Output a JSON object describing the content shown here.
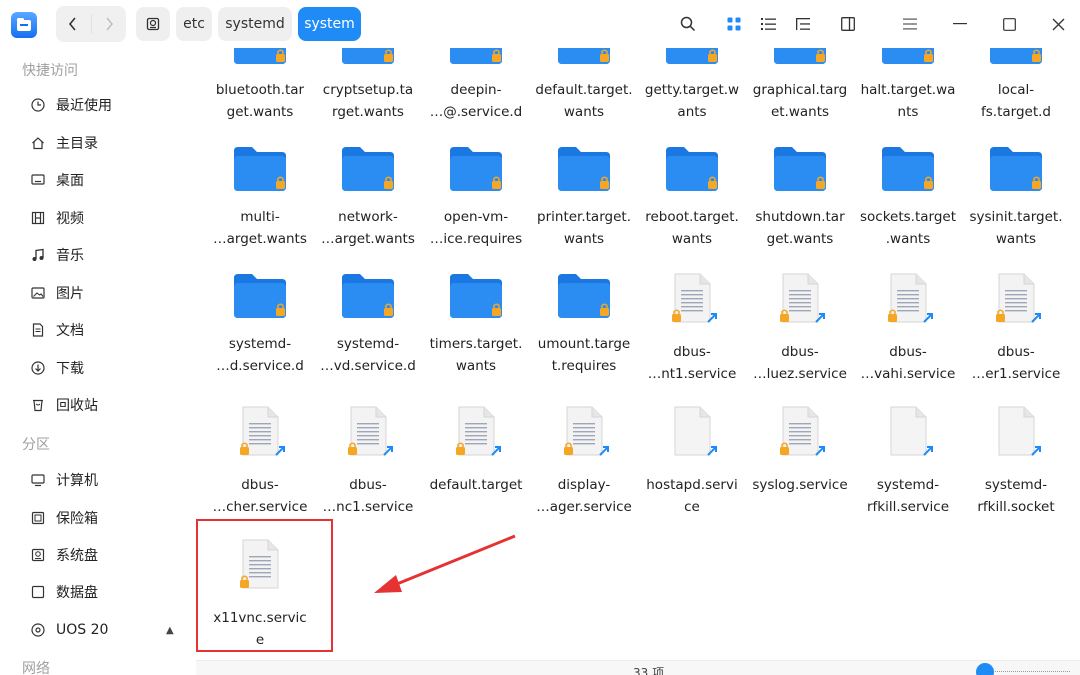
{
  "titlebar": {
    "breadcrumbs": [
      "etc",
      "systemd",
      "system"
    ],
    "back_icon": "chevron-left",
    "forward_icon": "chevron-right",
    "drive_icon": "disk-icon"
  },
  "sidebar": {
    "groups": {
      "quick": "快捷访问",
      "partitions": "分区",
      "network": "网络"
    },
    "quick_items": [
      "最近使用",
      "主目录",
      "桌面",
      "视频",
      "音乐",
      "图片",
      "文档",
      "下载",
      "回收站"
    ],
    "partition_items": [
      "计算机",
      "保险箱",
      "系统盘",
      "数据盘",
      "UOS 20"
    ]
  },
  "files": {
    "row0": [
      "bluetooth.target.wants",
      "cryptsetup.target.wants",
      "deepin-…@.service.d",
      "default.target.wants",
      "getty.target.wants",
      "graphical.target.wants",
      "halt.target.wants",
      "local-fs.target.d"
    ],
    "row1": [
      "multi-…arget.wants",
      "network-…arget.wants",
      "open-vm-…ice.requires",
      "printer.target.wants",
      "reboot.target.wants",
      "shutdown.target.wants",
      "sockets.target.wants",
      "sysinit.target.wants"
    ],
    "row2": [
      "systemd-…d.service.d",
      "systemd-…vd.service.d",
      "timers.target.wants",
      "umount.target.requires",
      "dbus-…nt1.service",
      "dbus-…luez.service",
      "dbus-…vahi.service",
      "dbus-…er1.service"
    ],
    "row3": [
      "dbus-…cher.service",
      "dbus-…nc1.service",
      "default.target",
      "display-…ager.service",
      "hostapd.service",
      "syslog.service",
      "systemd-rfkill.service",
      "systemd-rfkill.socket"
    ],
    "row4": [
      "x11vnc.service"
    ],
    "row0_wrapped": [
      "bluetooth.tar\nget.wants",
      "cryptsetup.ta\nrget.wants",
      "deepin-\n…@.service.d",
      "default.target.\nwants",
      "getty.target.w\nants",
      "graphical.targ\net.wants",
      "halt.target.wa\nnts",
      "local-\nfs.target.d"
    ],
    "row1_wrapped": [
      "multi-\n…arget.wants",
      "network-\n…arget.wants",
      "open-vm-\n…ice.requires",
      "printer.target.\nwants",
      "reboot.target.\nwants",
      "shutdown.tar\nget.wants",
      "sockets.target\n.wants",
      "sysinit.target.\nwants"
    ],
    "row2_wrapped": [
      "systemd-\n…d.service.d",
      "systemd-\n…vd.service.d",
      "timers.target.\nwants",
      "umount.targe\nt.requires",
      "dbus-\n…nt1.service",
      "dbus-\n…luez.service",
      "dbus-\n…vahi.service",
      "dbus-\n…er1.service"
    ],
    "row3_wrapped": [
      "dbus-\n…cher.service",
      "dbus-\n…nc1.service",
      "default.target",
      "display-\n…ager.service",
      "hostapd.servi\nce",
      "syslog.service",
      "systemd-\nrfkill.service",
      "systemd-\nrfkill.socket"
    ],
    "row4_wrapped": [
      "x11vnc.servic\ne"
    ]
  },
  "statusbar": {
    "count": "33 项"
  },
  "colors": {
    "accent": "#1e8bf7",
    "folder": "#2b8df2",
    "lock": "#f5a623",
    "highlight": "#e53232"
  }
}
